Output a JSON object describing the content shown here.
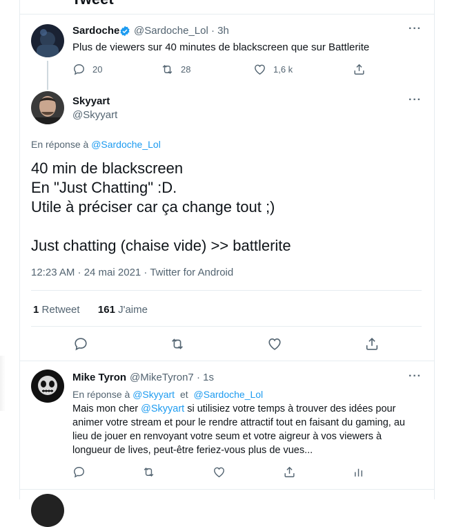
{
  "header": {
    "title": "Tweet"
  },
  "tweet1": {
    "name": "Sardoche",
    "handle": "@Sardoche_Lol",
    "time": "3h",
    "text": "Plus de viewers sur 40 minutes de blackscreen que sur Battlerite",
    "replies": "20",
    "retweets": "28",
    "likes": "1,6 k"
  },
  "main": {
    "name": "Skyyart",
    "handle": "@Skyyart",
    "reply_prefix": "En réponse à",
    "reply_to": "@Sardoche_Lol",
    "lines": [
      "40 min de blackscreen",
      "En \"Just Chatting\" :D.",
      "Utile à préciser car ça change tout ;)",
      "",
      "Just chatting (chaise vide) >> battlerite"
    ],
    "meta": "12:23 AM · 24 mai 2021 · Twitter for Android",
    "retweet_count": "1",
    "retweet_label": "Retweet",
    "like_count": "161",
    "like_label": "J'aime"
  },
  "reply": {
    "name": "Mike Tyron",
    "handle": "@MikeTyron7",
    "time": "1s",
    "reply_prefix": "En réponse à",
    "reply_to_1": "@Skyyart",
    "reply_and": "et",
    "reply_to_2": "@Sardoche_Lol",
    "text_lead": "Mais mon cher",
    "text_mention": "@Skyyart",
    "text_rest": " si utilisiez votre temps à trouver des idées pour animer votre stream et pour le rendre attractif tout en faisant du gaming, au lieu de jouer en renvoyant votre seum et votre aigreur à vos viewers à longueur de lives, peut-être feriez-vous plus de vues..."
  },
  "icons": {
    "more": "more-icon",
    "reply": "reply-icon",
    "retweet": "retweet-icon",
    "like": "heart-icon",
    "share": "share-icon",
    "analytics": "analytics-icon",
    "verified": "verified-badge-icon"
  },
  "colors": {
    "accent": "#1d9bf0",
    "muted": "#536471",
    "border": "#e6ecf0"
  }
}
